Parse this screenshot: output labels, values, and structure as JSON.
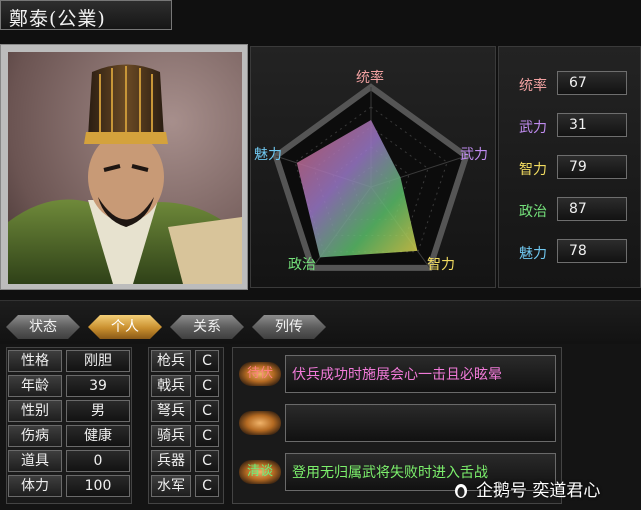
{
  "header": {
    "name": "鄭泰(公業)"
  },
  "radar": {
    "labels": {
      "leadership": "统率",
      "war": "武力",
      "intellect": "智力",
      "politics": "政治",
      "charisma": "魅力"
    },
    "colors": {
      "leadership": "#f0a0a0",
      "war": "#c08cf0",
      "intellect": "#f2dc60",
      "politics": "#74e07a",
      "charisma": "#70c8f0"
    },
    "max_value": 100,
    "values": {
      "leadership": 67,
      "war": 31,
      "intellect": 79,
      "politics": 87,
      "charisma": 78
    }
  },
  "stats": [
    {
      "label": "统率",
      "value": "67",
      "color": "#f0a0a0"
    },
    {
      "label": "武力",
      "value": "31",
      "color": "#c08cf0"
    },
    {
      "label": "智力",
      "value": "79",
      "color": "#f2dc60"
    },
    {
      "label": "政治",
      "value": "87",
      "color": "#74e07a"
    },
    {
      "label": "魅力",
      "value": "78",
      "color": "#70c8f0"
    }
  ],
  "tabs": [
    {
      "label": "状态"
    },
    {
      "label": "个人"
    },
    {
      "label": "关系"
    },
    {
      "label": "列传"
    }
  ],
  "attributes": [
    {
      "label": "性格",
      "value": "刚胆"
    },
    {
      "label": "年龄",
      "value": "39"
    },
    {
      "label": "性别",
      "value": "男"
    },
    {
      "label": "伤病",
      "value": "健康"
    },
    {
      "label": "道具",
      "value": "0"
    },
    {
      "label": "体力",
      "value": "100"
    }
  ],
  "troops": [
    {
      "label": "枪兵",
      "grade": "C"
    },
    {
      "label": "戟兵",
      "grade": "C"
    },
    {
      "label": "弩兵",
      "grade": "C"
    },
    {
      "label": "骑兵",
      "grade": "C"
    },
    {
      "label": "兵器",
      "grade": "C"
    },
    {
      "label": "水军",
      "grade": "C"
    }
  ],
  "skills": [
    {
      "tag": "待伏",
      "desc": "伏兵成功时施展会心一击且必眩晕",
      "tag_color": "#ff8080",
      "desc_color": "#f07ad8"
    },
    {
      "tag": "",
      "desc": "",
      "tag_color": "#ff8080",
      "desc_color": "#f07ad8"
    },
    {
      "tag": "清谈",
      "desc": "登用无归属武将失败时进入舌战",
      "tag_color": "#6cf07a",
      "desc_color": "#7cf06c"
    }
  ],
  "watermark": "企鹅号 奕道君心"
}
